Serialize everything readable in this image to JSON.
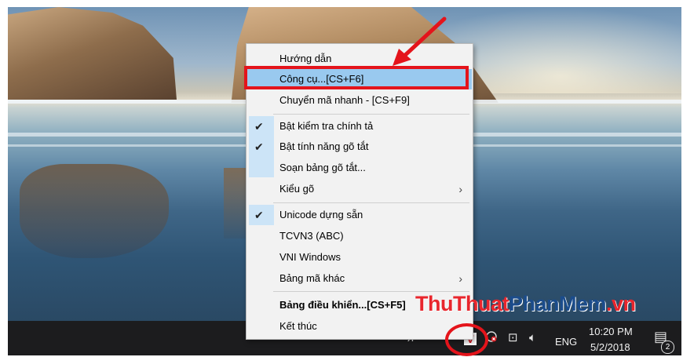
{
  "menu": {
    "items": [
      {
        "label": "Hướng dẫn",
        "checked": false,
        "submenu": false,
        "bold": false
      },
      {
        "label": "Công cụ...[CS+F6]",
        "checked": false,
        "submenu": false,
        "bold": false,
        "highlighted": true
      },
      {
        "label": "Chuyển mã nhanh - [CS+F9]",
        "checked": false,
        "submenu": false,
        "bold": false
      },
      {
        "label": "Bật kiểm tra chính tả",
        "checked": true,
        "submenu": false,
        "bold": false
      },
      {
        "label": "Bật tính năng gõ tắt",
        "checked": true,
        "submenu": false,
        "bold": false
      },
      {
        "label": "Soạn bảng gõ tắt...",
        "checked": false,
        "submenu": false,
        "bold": false
      },
      {
        "label": "Kiểu gõ",
        "checked": false,
        "submenu": true,
        "bold": false
      },
      {
        "label": "Unicode dựng sẵn",
        "checked": true,
        "submenu": false,
        "bold": false
      },
      {
        "label": "TCVN3 (ABC)",
        "checked": false,
        "submenu": false,
        "bold": false
      },
      {
        "label": "VNI Windows",
        "checked": false,
        "submenu": false,
        "bold": false
      },
      {
        "label": "Bảng mã khác",
        "checked": false,
        "submenu": true,
        "bold": false
      },
      {
        "label": "Bảng điều khiển...[CS+F5]",
        "checked": false,
        "submenu": false,
        "bold": true
      },
      {
        "label": "Kết thúc",
        "checked": false,
        "submenu": false,
        "bold": false
      }
    ],
    "check_glyph": "✔",
    "submenu_glyph": "›"
  },
  "taskbar": {
    "language": "ENG",
    "time": "10:20 PM",
    "date": "5/2/2018",
    "notification_count": "2",
    "tray_icons": [
      "people-icon",
      "show-hidden-chevron-icon",
      "vietkey-unikey-icon",
      "network-error-icon",
      "network-icon",
      "volume-icon",
      "action-center-icon"
    ]
  },
  "tray_glyphs": {
    "people": "ᴙ",
    "chevron": "^",
    "vietkey": "V",
    "network": "⊡",
    "volume": "🔈︎",
    "action_center": "▤"
  },
  "watermark": {
    "part1": "ThuThuat",
    "part2": "PhanMem",
    "part3": ".vn"
  },
  "colors": {
    "highlight": "#99c9ef",
    "annotation": "#e4141b",
    "taskbar": "#1c1c1e",
    "menu_bg": "#f2f2f2"
  }
}
